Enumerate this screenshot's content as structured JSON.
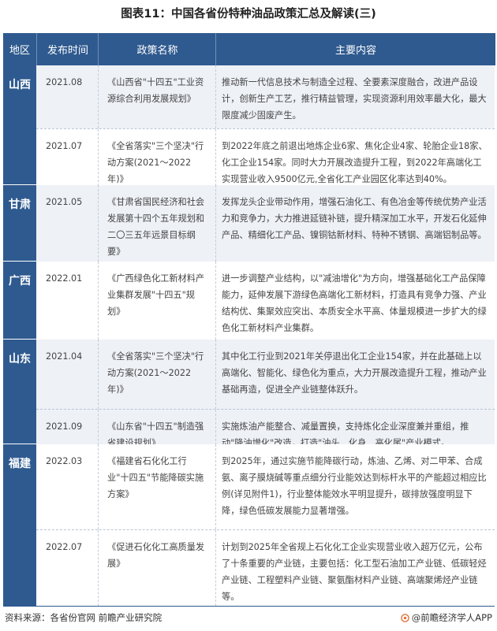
{
  "title": "图表11：中国各省份特种油品政策汇总及解读(三)",
  "headers": [
    "地区",
    "发布时间",
    "政策名称",
    "主要内容"
  ],
  "regions": [
    {
      "name": "山西"
    },
    {
      "name": "甘肃"
    },
    {
      "name": "广西"
    },
    {
      "name": "山东"
    },
    {
      "name": "福建"
    }
  ],
  "rows": [
    {
      "date": "2021.08",
      "name": "《山西省\"十四五\"工业资源综合利用发展规划》",
      "content": "推动新一代信息技术与制造全过程、全要素深度融合，改进产品设计，创新生产工艺，推行精益管理，实现资源利用效率最大化，最大限度减少固废产生。"
    },
    {
      "date": "2021.07",
      "name": "《全省落实\"三个坚决\"行动方案(2021～2022年)》",
      "content": "到2022年底之前退出地炼企业6家、焦化企业4家、轮胎企业18家、化工企业154家。同时大力开展改造提升工程，到2022年高端化工实现营业收入9500亿元,全省化工产业园区化率达到40%。"
    },
    {
      "date": "2021.05",
      "name": "《甘肃省国民经济和社会发展第十四个五年规划和二〇三五年远景目标纲要》",
      "content": "发挥龙头企业带动作用，增强石油化工、有色冶金等传统优势产业活力和竞争力，大力推进延链补链，提升精深加工水平，开发石化延伸产品、精细化工产品、镍铜钴新材料、特种不锈钢、高端铝制品等。"
    },
    {
      "date": "2022.01",
      "name": "《广西绿色化工新材料产业集群发展\"十四五\"规划》",
      "content": "进一步调整产业结构，以\"减油增化\"为方向，增强基础化工产品保障能力，延伸发展下游绿色高端化工新材料，打造具有竞争力强、产业结构优、集聚效应突出、本质安全水平高、体量规模进一步扩大的绿色化工新材料产业集群。"
    },
    {
      "date": "2021.04",
      "name": "《全省落实\"三个坚决\"行动方案(2021～2022年)》",
      "content": "其中化工行业到2021年关停退出化工企业154家，并在此基础上以高端化、智能化、绿色化为重点，大力开展改造提升工程，推动产业基础再造，促进全产业链整体跃升。"
    },
    {
      "date": "2021.09",
      "name": "《山东省\"十四五\"制造强省建设规划》",
      "content": "实施炼油产能整合、减量置换，支持炼化企业深度兼并重组，推动\"降油增化\"改造，打造\"油头、化身、高化尾\"产业模式。"
    },
    {
      "date": "2022.03",
      "name": "《福建省石化化工行业\"十四五\"节能降碳实施方案》",
      "content": "到2025年，通过实施节能降碳行动，炼油、乙烯、对二甲苯、合成氨、离子膜烧碱等重点细分行业能效达到标杆水平的产能超过相应比例(详见附件1)，行业整体能效水平明显提升，碳排放强度明显下降，绿色低碳发展能力显著增强。"
    },
    {
      "date": "2022.07",
      "name": "《促进石化化工高质量发展》",
      "content": "计划到2025年全省规上石化化工企业实现营业收入超万亿元，公布了十条重要的产业链，主要包括：化工型石油加工产业链、低碳轻烃产业链、工程塑料产业链、聚氨酯材料产业链、高端聚烯烃产业链等。"
    }
  ],
  "footer": {
    "source": "资料来源：各省份官网 前瞻产业研究院",
    "brand": "@前瞻经济学人APP"
  },
  "colors": {
    "header_bg": "#2f5a8f",
    "row_shade": "#eef1f6"
  }
}
